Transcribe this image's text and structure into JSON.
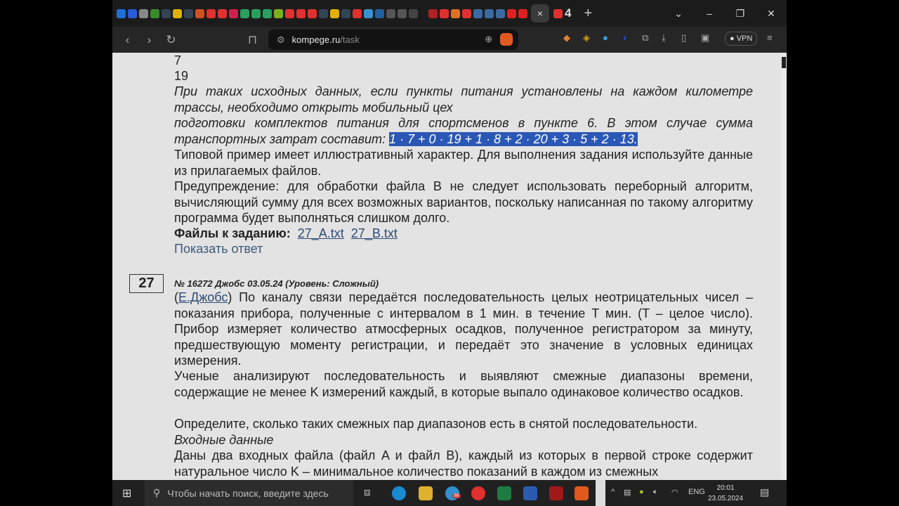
{
  "browser": {
    "tab_favicons": [
      {
        "icon": "mail-icon",
        "color": "#1e6fd6"
      },
      {
        "icon": "mail-icon",
        "color": "#2a5bd7"
      },
      {
        "icon": "photo-icon",
        "color": "#888"
      },
      {
        "icon": "hd-icon",
        "color": "#3a8a2a"
      },
      {
        "icon": "globe-icon",
        "color": "#345"
      },
      {
        "icon": "paragraph-icon",
        "color": "#e0b000"
      },
      {
        "icon": "globe-icon",
        "color": "#345"
      },
      {
        "icon": "dots-icon",
        "color": "#d05020"
      },
      {
        "icon": "yandex-icon",
        "color": "#e03030"
      },
      {
        "icon": "star-icon",
        "color": "#e03030"
      },
      {
        "icon": "ring-icon",
        "color": "#d02050"
      },
      {
        "icon": "dots-icon",
        "color": "#2aa060"
      },
      {
        "icon": "dots-icon",
        "color": "#2aa060"
      },
      {
        "icon": "dots-icon",
        "color": "#2aa060"
      },
      {
        "icon": "letter-a-icon",
        "color": "#7ab020"
      },
      {
        "icon": "star-icon",
        "color": "#e03030"
      },
      {
        "icon": "yandex-icon",
        "color": "#e03030"
      },
      {
        "icon": "star-icon",
        "color": "#e03030"
      },
      {
        "icon": "globe-icon",
        "color": "#345"
      },
      {
        "icon": "paragraph-icon",
        "color": "#e0b000"
      },
      {
        "icon": "globe-icon",
        "color": "#345"
      },
      {
        "icon": "yandex-icon",
        "color": "#e03030"
      },
      {
        "icon": "help-icon",
        "color": "#3a90d0"
      },
      {
        "icon": "s-icon",
        "color": "#2060a0"
      },
      {
        "icon": "globe-icon",
        "color": "#555"
      },
      {
        "icon": "globe-icon",
        "color": "#555"
      },
      {
        "icon": "feather-icon",
        "color": "#444"
      }
    ],
    "tab_favicons_2": [
      {
        "icon": "record-icon",
        "color": "#b02020"
      },
      {
        "icon": "yandex-icon",
        "color": "#e03030"
      },
      {
        "icon": "box-icon",
        "color": "#e07020"
      },
      {
        "icon": "yandex-icon",
        "color": "#e03030"
      },
      {
        "icon": "figure-icon",
        "color": "#3a6aa0"
      },
      {
        "icon": "figure-icon",
        "color": "#3a6aa0"
      },
      {
        "icon": "figure-icon",
        "color": "#3a6aa0"
      },
      {
        "icon": "youtube-icon",
        "color": "#e02020"
      },
      {
        "icon": "youtube-icon",
        "color": "#e02020"
      }
    ],
    "active_tab_close": "×",
    "tab_count": "4",
    "new_tab": "+",
    "url_host": "kompege.ru",
    "url_path": "/task",
    "vpn_label": "VPN"
  },
  "content": {
    "line_7": "7",
    "line_19": "19",
    "para_italic_1": "При таких исходных данных, если пункты питания установлены на каждом километре трассы, необходимо открыть мобильный цех",
    "para_italic_2": "подготовки комплектов питания для спортсменов в пункте 6. В этом случае сумма транспортных затрат составит: ",
    "selected_formula": "1 · 7 + 0 · 19 + 1 · 8 + 2 · 20 + 3 · 5 + 2 · 13.",
    "para_example": "Типовой пример имеет иллюстративный характер. Для выполнения задания используйте данные из прилагаемых файлов.",
    "para_warning": "Предупреждение: для обработки файла B не следует использовать переборный алгоритм, вычисляющий сумму для всех возможных вариантов, поскольку написанная по такому алгоритму программа будет выполняться слишком долго.",
    "files_label": "Файлы к заданию:",
    "file_a": "27_A.txt",
    "file_b": "27_B.txt",
    "show_answer": "Показать ответ",
    "task_number": "27",
    "task_meta": "№ 16272 Джобс 03.05.24 (Уровень: Сложный)",
    "author_link": "Е.Джобс",
    "task_p1": ") По каналу связи передаётся последовательность целых неотрицательных чисел – показания прибора, полученные с интервалом в 1 мин. в течение T мин. (T – целое число). Прибор измеряет количество атмосферных осадков, полученное регистратором за минуту, предшествующую моменту регистрации, и передаёт это значение в условных единицах измерения.",
    "task_p2": "Ученые анализируют последовательность и выявляют смежные диапазоны времени, содержащие не менее K измерений каждый, в которые выпало одинаковое количество осадков.",
    "task_p3": "Определите, сколько таких смежных пар диапазонов есть в снятой последовательности.",
    "input_heading": "Входные данные",
    "input_p": "Даны два входных файла (файл A и файл B), каждый из которых в первой строке содержит натуральное число K – минимальное количество показаний в каждом из смежных"
  },
  "taskbar": {
    "search_placeholder": "Чтобы начать поиск, введите здесь",
    "telegram_badge": "88",
    "language": "ENG",
    "time": "20:01",
    "date": "23.05.2024"
  }
}
